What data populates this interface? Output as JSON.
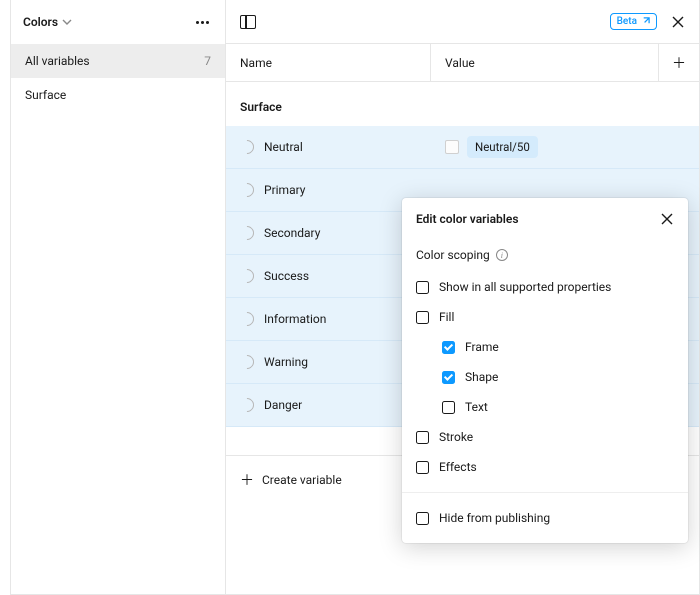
{
  "sidebar": {
    "collection_name": "Colors",
    "all_variables_label": "All variables",
    "all_variables_count": "7",
    "groups": [
      {
        "label": "Surface"
      }
    ]
  },
  "header": {
    "beta_label": "Beta"
  },
  "table": {
    "name_header": "Name",
    "value_header": "Value",
    "group_label": "Surface",
    "rows": [
      {
        "name": "Neutral",
        "alias": "Neutral/50"
      },
      {
        "name": "Primary"
      },
      {
        "name": "Secondary"
      },
      {
        "name": "Success"
      },
      {
        "name": "Information"
      },
      {
        "name": "Warning"
      },
      {
        "name": "Danger"
      }
    ],
    "create_label": "Create variable"
  },
  "edit_panel": {
    "title": "Edit color variables",
    "scoping_label": "Color scoping",
    "options": {
      "show_all": {
        "label": "Show in all supported properties",
        "checked": false
      },
      "fill": {
        "label": "Fill",
        "checked": false
      },
      "frame": {
        "label": "Frame",
        "checked": true
      },
      "shape": {
        "label": "Shape",
        "checked": true
      },
      "text": {
        "label": "Text",
        "checked": false
      },
      "stroke": {
        "label": "Stroke",
        "checked": false
      },
      "effects": {
        "label": "Effects",
        "checked": false
      },
      "hide_publish": {
        "label": "Hide from publishing",
        "checked": false
      }
    }
  }
}
